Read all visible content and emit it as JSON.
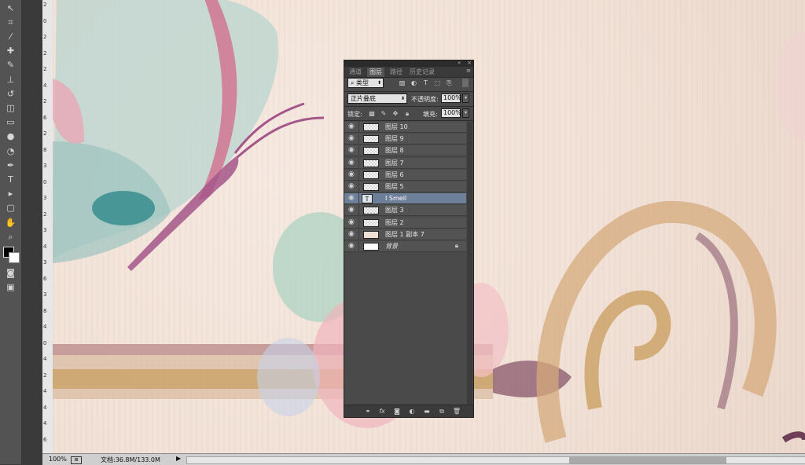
{
  "tools": [
    {
      "icon": "move-icon",
      "glyph": "↖"
    },
    {
      "icon": "crop-icon",
      "glyph": "⌗"
    },
    {
      "icon": "eyedropper-icon",
      "glyph": "⁄"
    },
    {
      "icon": "healing-brush-icon",
      "glyph": "✚"
    },
    {
      "icon": "brush-icon",
      "glyph": "✎"
    },
    {
      "icon": "clone-stamp-icon",
      "glyph": "⊥"
    },
    {
      "icon": "history-brush-icon",
      "glyph": "↺"
    },
    {
      "icon": "eraser-icon",
      "glyph": "◫"
    },
    {
      "icon": "gradient-icon",
      "glyph": "▭"
    },
    {
      "icon": "blur-icon",
      "glyph": "●"
    },
    {
      "icon": "dodge-icon",
      "glyph": "◔"
    },
    {
      "icon": "pen-icon",
      "glyph": "✒"
    },
    {
      "icon": "type-icon",
      "glyph": "T"
    },
    {
      "icon": "path-selection-icon",
      "glyph": "▸"
    },
    {
      "icon": "shape-icon",
      "glyph": "▢"
    },
    {
      "icon": "hand-icon",
      "glyph": "✋"
    },
    {
      "icon": "zoom-icon",
      "glyph": "⌕"
    }
  ],
  "colors": {
    "foreground": "#000000",
    "background": "#ffffff",
    "selected_layer": "#6e7f99"
  },
  "ruler_labels": [
    "2",
    "0",
    "2",
    "2",
    "2",
    "4",
    "2",
    "6",
    "2",
    "8",
    "3",
    "0",
    "3",
    "2",
    "3",
    "4",
    "3",
    "6",
    "3",
    "8",
    "4",
    "0",
    "4",
    "2",
    "4",
    "4",
    "4",
    "6"
  ],
  "panel": {
    "tabs": [
      "通道",
      "图层",
      "路径",
      "历史记录"
    ],
    "active_tab": "图层",
    "filter_kind": "类型",
    "blend_mode": "正片叠底",
    "opacity_label": "不透明度:",
    "opacity_value": "100%",
    "lock_label": "锁定:",
    "fill_label": "填充:",
    "fill_value": "100%",
    "layers": [
      {
        "name": "图层 10",
        "thumb": "transparent"
      },
      {
        "name": "图层 9",
        "thumb": "transparent"
      },
      {
        "name": "图层 8",
        "thumb": "transparent"
      },
      {
        "name": "图层 7",
        "thumb": "transparent"
      },
      {
        "name": "图层 6",
        "thumb": "transparent"
      },
      {
        "name": "图层 5",
        "thumb": "transparent"
      },
      {
        "name": "I Smell",
        "thumb": "text",
        "selected": true
      },
      {
        "name": "图层 3",
        "thumb": "transparent"
      },
      {
        "name": "图层 2",
        "thumb": "transparent"
      },
      {
        "name": "图层 1 副本 7",
        "thumb": "texture"
      },
      {
        "name": "背景",
        "thumb": "white",
        "locked": true,
        "italic": true
      }
    ]
  },
  "status": {
    "zoom": "100%",
    "doc_size": "文档:36.8M/133.0M"
  }
}
